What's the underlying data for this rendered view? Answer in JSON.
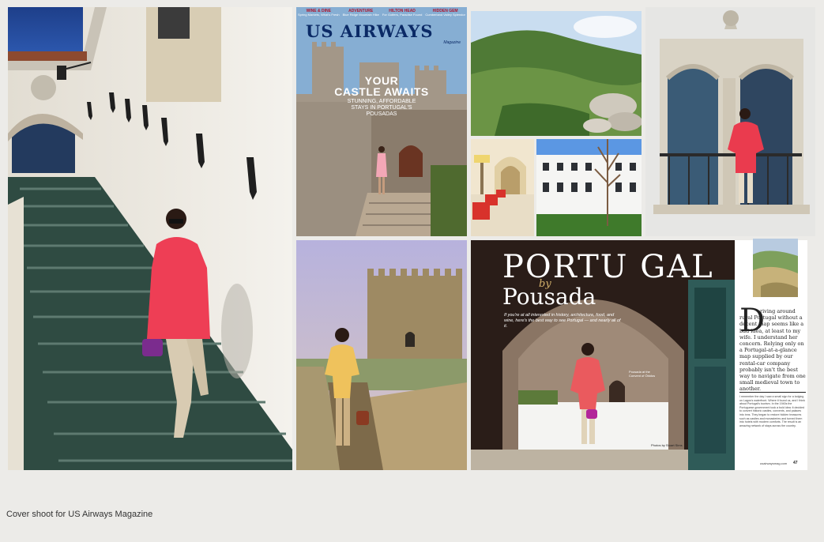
{
  "caption": "Cover shoot for US Airways Magazine",
  "cover": {
    "menu": [
      {
        "category": "WINE & DINE",
        "sub": "Spring Markets, What's Fresh"
      },
      {
        "category": "ADVENTURE",
        "sub": "Blue Ridge Mountain Hike"
      },
      {
        "category": "HILTON HEAD",
        "sub": "For Golfers, Paradise Found"
      },
      {
        "category": "HIDDEN GEM",
        "sub": "Cumberland Valley Splendor"
      }
    ],
    "title": "US AIRWAYS",
    "magazine_label": "Magazine",
    "headline_1": "YOUR",
    "headline_2": "CASTLE AWAITS",
    "subhead_1": "STUNNING, AFFORDABLE",
    "subhead_2": "STAYS IN PORTUGAL'S",
    "subhead_3": "POUSADAS"
  },
  "spread": {
    "title": "PORTU GAL",
    "by": "by",
    "title_2": "Pousada",
    "intro": "If you're at all interested in history, architecture, food, and wine, here's the best way to see Portugal — and nearly all of it.",
    "photo_caption": "Pousada at the Convent of Óbidos",
    "credit": "Photos by Stuart Sims"
  },
  "article": {
    "dropcap": "D",
    "body": "riving around rural Portugal without a decent map seems like a bad idea, at least to my wife. I understand her concern. Relying only on a Portugal-at-a-glance map supplied by our rental-car company probably isn't the best way to navigate from one small medieval town to another.",
    "small_copy": "I remember the day I saw a small sign for a lodging on Lagos's waterfront. Where it found us, and I think about Portugal's tourism. In the 1940s the Portuguese government took a bold idea: it decided to convert historic castles, convents, and palaces into inns. They began to restore hidden treasures such as castles and monasteries and turned them into hotels with modern comforts. The result is an amazing network of stays across the country.",
    "footer": "usairwaysmag.com",
    "page_number": "47"
  }
}
